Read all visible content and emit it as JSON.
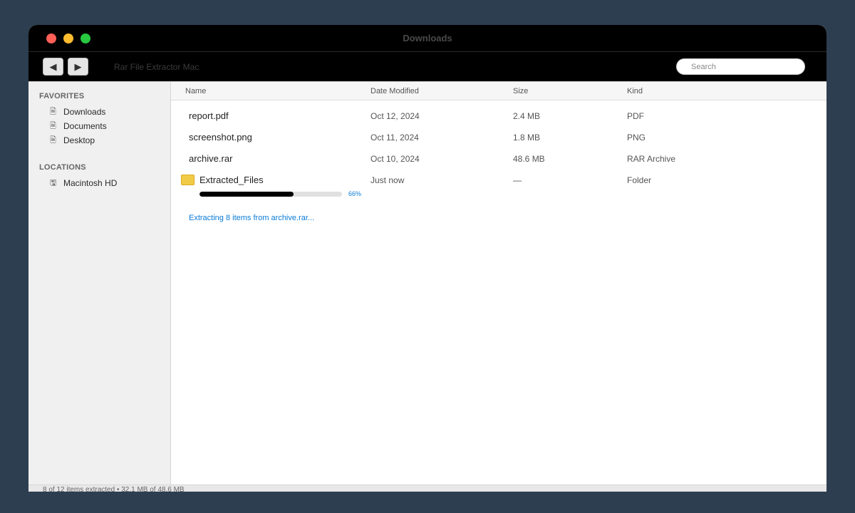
{
  "window": {
    "title": "Downloads"
  },
  "toolbar": {
    "back_icon": "◀",
    "forward_icon": "▶",
    "app_name": "Rar File Extractor Mac",
    "search_placeholder": "Search"
  },
  "sidebar": {
    "favorites_heading": "FAVORITES",
    "favorites": [
      {
        "label": "Downloads",
        "icon": "📄"
      },
      {
        "label": "Documents",
        "icon": "📄"
      },
      {
        "label": "Desktop",
        "icon": "📄"
      }
    ],
    "locations_heading": "LOCATIONS",
    "locations": [
      {
        "label": "Macintosh HD",
        "icon": "💾"
      }
    ]
  },
  "columns": {
    "name": "Name",
    "date": "Date Modified",
    "size": "Size",
    "kind": "Kind"
  },
  "files": [
    {
      "name": "report.pdf",
      "date": "Oct 12, 2024",
      "size": "2.4 MB",
      "kind": "PDF"
    },
    {
      "name": "screenshot.png",
      "date": "Oct 11, 2024",
      "size": "1.8 MB",
      "kind": "PNG"
    },
    {
      "name": "archive.rar",
      "date": "Oct 10, 2024",
      "size": "48.6 MB",
      "kind": "RAR Archive"
    },
    {
      "name": "Extracted_Files",
      "date": "Just now",
      "size": "—",
      "kind": "Folder"
    }
  ],
  "extraction": {
    "progress_fraction": 0.66,
    "percent_label": "66%",
    "message": "Extracting 8 items from archive.rar..."
  },
  "status": {
    "text": "8 of 12 items extracted • 32.1 MB of 48.6 MB"
  },
  "colors": {
    "accent": "#0a7bd6",
    "folder": "#f2cb46"
  }
}
